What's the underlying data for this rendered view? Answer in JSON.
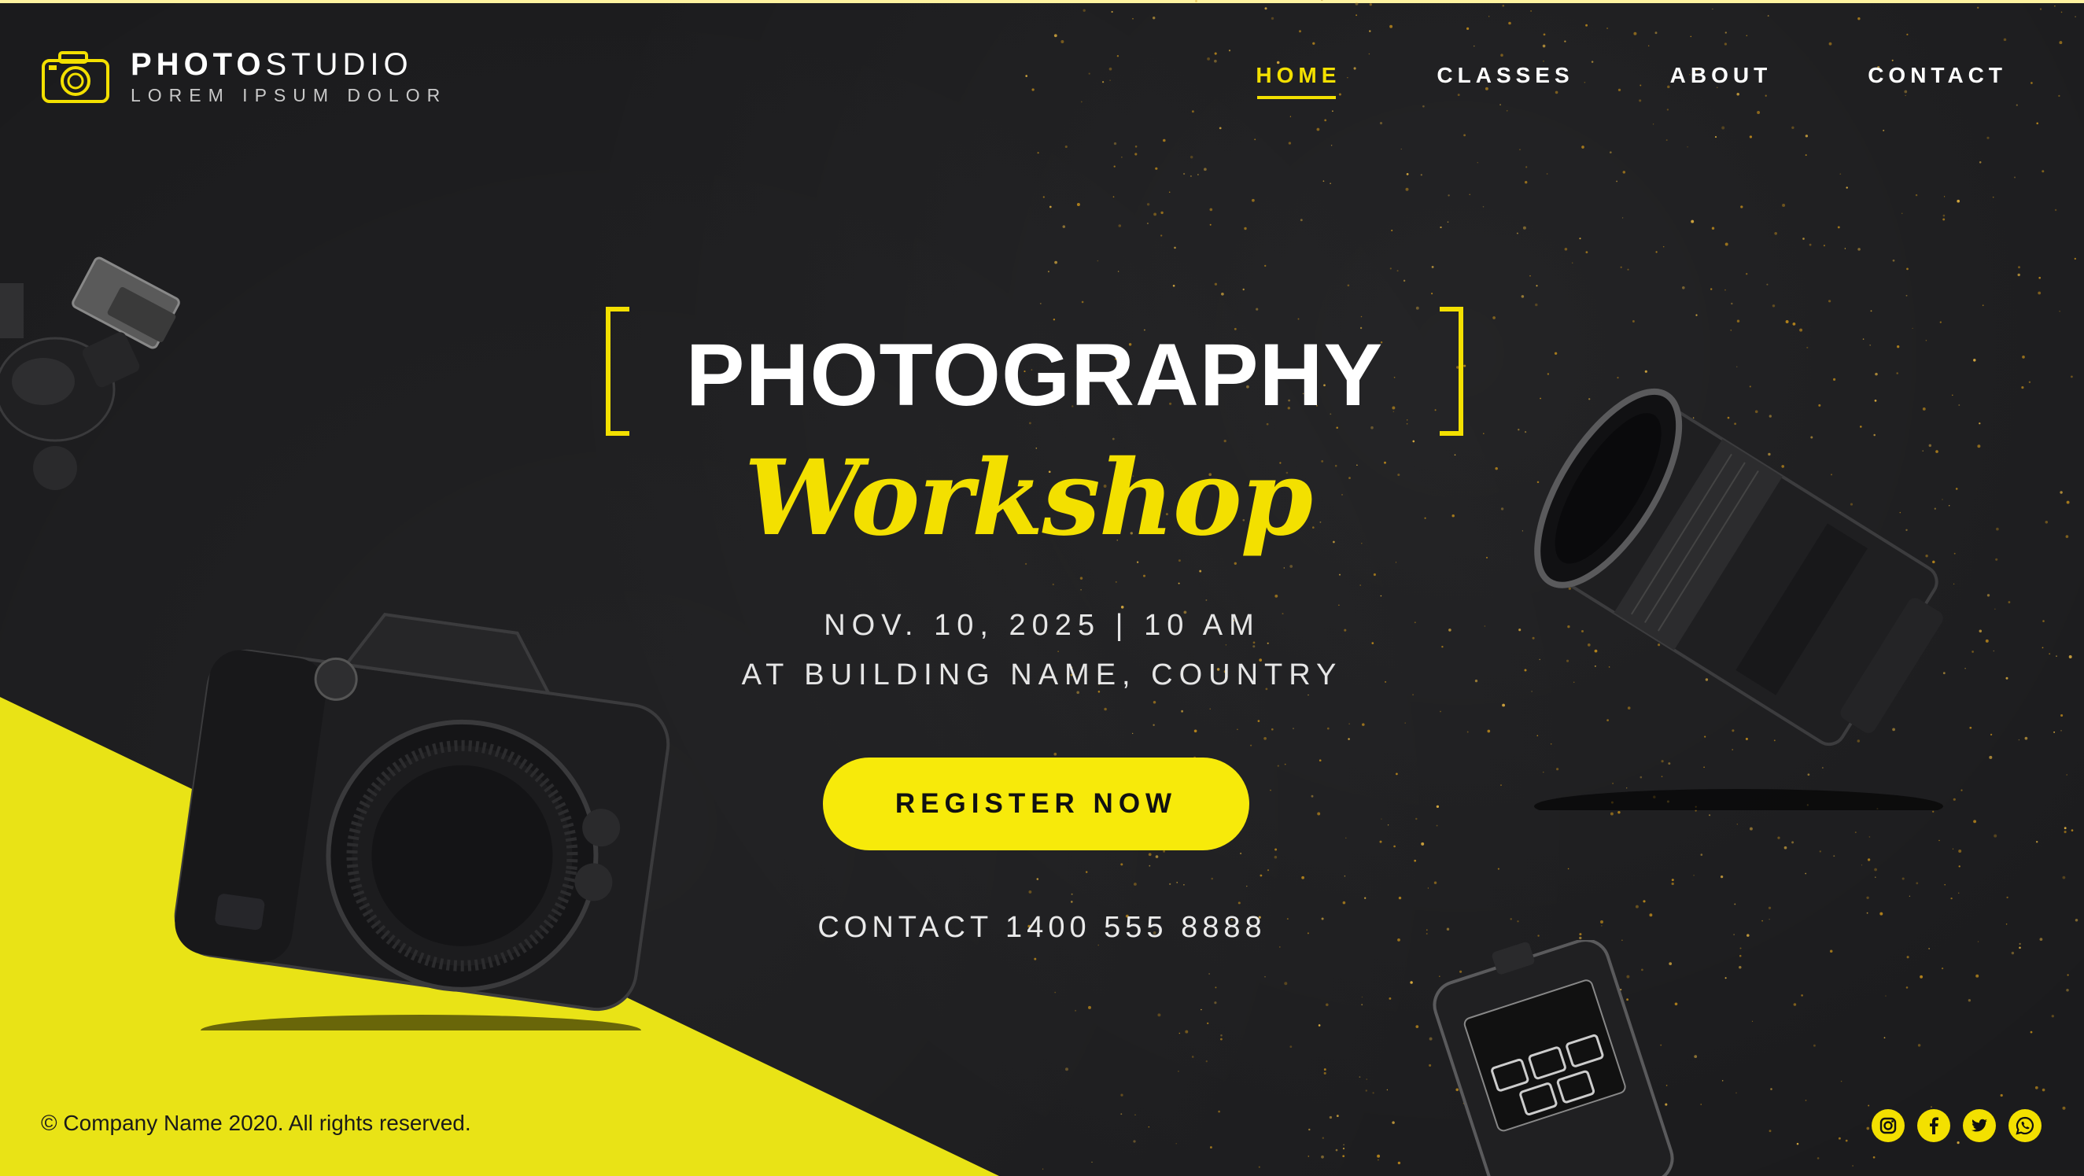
{
  "brand": {
    "title_bold": "PHOTO",
    "title_light": "STUDIO",
    "tagline": "LOREM IPSUM DOLOR",
    "icon": "camera-outline-icon"
  },
  "nav": {
    "items": [
      {
        "label": "HOME",
        "active": true
      },
      {
        "label": "CLASSES",
        "active": false
      },
      {
        "label": "ABOUT",
        "active": false
      },
      {
        "label": "CONTACT",
        "active": false
      }
    ]
  },
  "hero": {
    "title": "PHOTOGRAPHY",
    "script": "Workshop",
    "date": "NOV. 10, 2025  |  10 AM",
    "place": "AT BUILDING NAME, COUNTRY",
    "cta": "REGISTER NOW",
    "contact": "CONTACT 1400 555 8888"
  },
  "footer": {
    "copyright": "© Company Name 2020. All rights reserved.",
    "socials": [
      "instagram-icon",
      "facebook-icon",
      "twitter-icon",
      "whatsapp-icon"
    ]
  },
  "colors": {
    "accent": "#f3e000",
    "background": "#1b1b1d",
    "wedge": "#e9e316"
  }
}
